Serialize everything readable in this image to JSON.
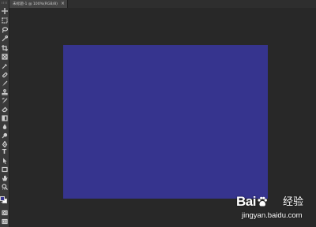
{
  "document_tab": {
    "title": "未标题-1 @ 100%(RGB/8)",
    "close_glyph": "×"
  },
  "canvas": {
    "fill_color": "#36348e"
  },
  "workspace": {
    "background_color": "#282828"
  },
  "colors": {
    "foreground": "#36348e",
    "background": "#ffffff"
  },
  "tools": [
    "move-tool",
    "marquee-tool",
    "lasso-tool",
    "quick-select-tool",
    "crop-tool",
    "frame-tool",
    "eyedropper-tool",
    "healing-brush-tool",
    "brush-tool",
    "clone-stamp-tool",
    "history-brush-tool",
    "eraser-tool",
    "gradient-tool",
    "blur-tool",
    "dodge-tool",
    "pen-tool",
    "type-tool",
    "path-select-tool",
    "rectangle-tool",
    "hand-tool",
    "zoom-tool",
    "more-tools"
  ],
  "type_tool_glyph": "T",
  "more_tools_glyph": "···",
  "watermark": {
    "brand": "Bai",
    "brand_tail": "经验",
    "url": "jingyan.baidu.com"
  }
}
